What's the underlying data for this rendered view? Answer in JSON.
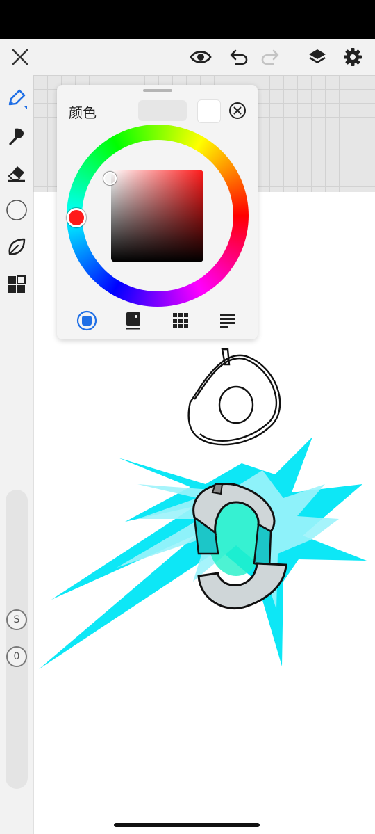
{
  "topbar": {
    "icons": [
      "close-icon",
      "eye-icon",
      "undo-icon",
      "redo-icon",
      "layers-icon",
      "gear-icon"
    ]
  },
  "sidebar": {
    "tools": [
      "pen-icon",
      "brush-icon",
      "eraser-icon",
      "circle-icon",
      "leaf-icon",
      "grid-icon"
    ],
    "size_button_label": "S",
    "opacity_button_label": "0"
  },
  "color_panel": {
    "title": "颜色",
    "current_color": "#ffffff",
    "previous_color": "#e6e6e6",
    "tabs": [
      "disc-tab",
      "classic-tab",
      "palette-tab",
      "value-tab"
    ],
    "active_tab": "disc-tab"
  },
  "colors": {
    "accent": "#1f6fe6",
    "toolbar_bg": "#f2f2f2",
    "drawing_cyan": "#00e6f5"
  }
}
